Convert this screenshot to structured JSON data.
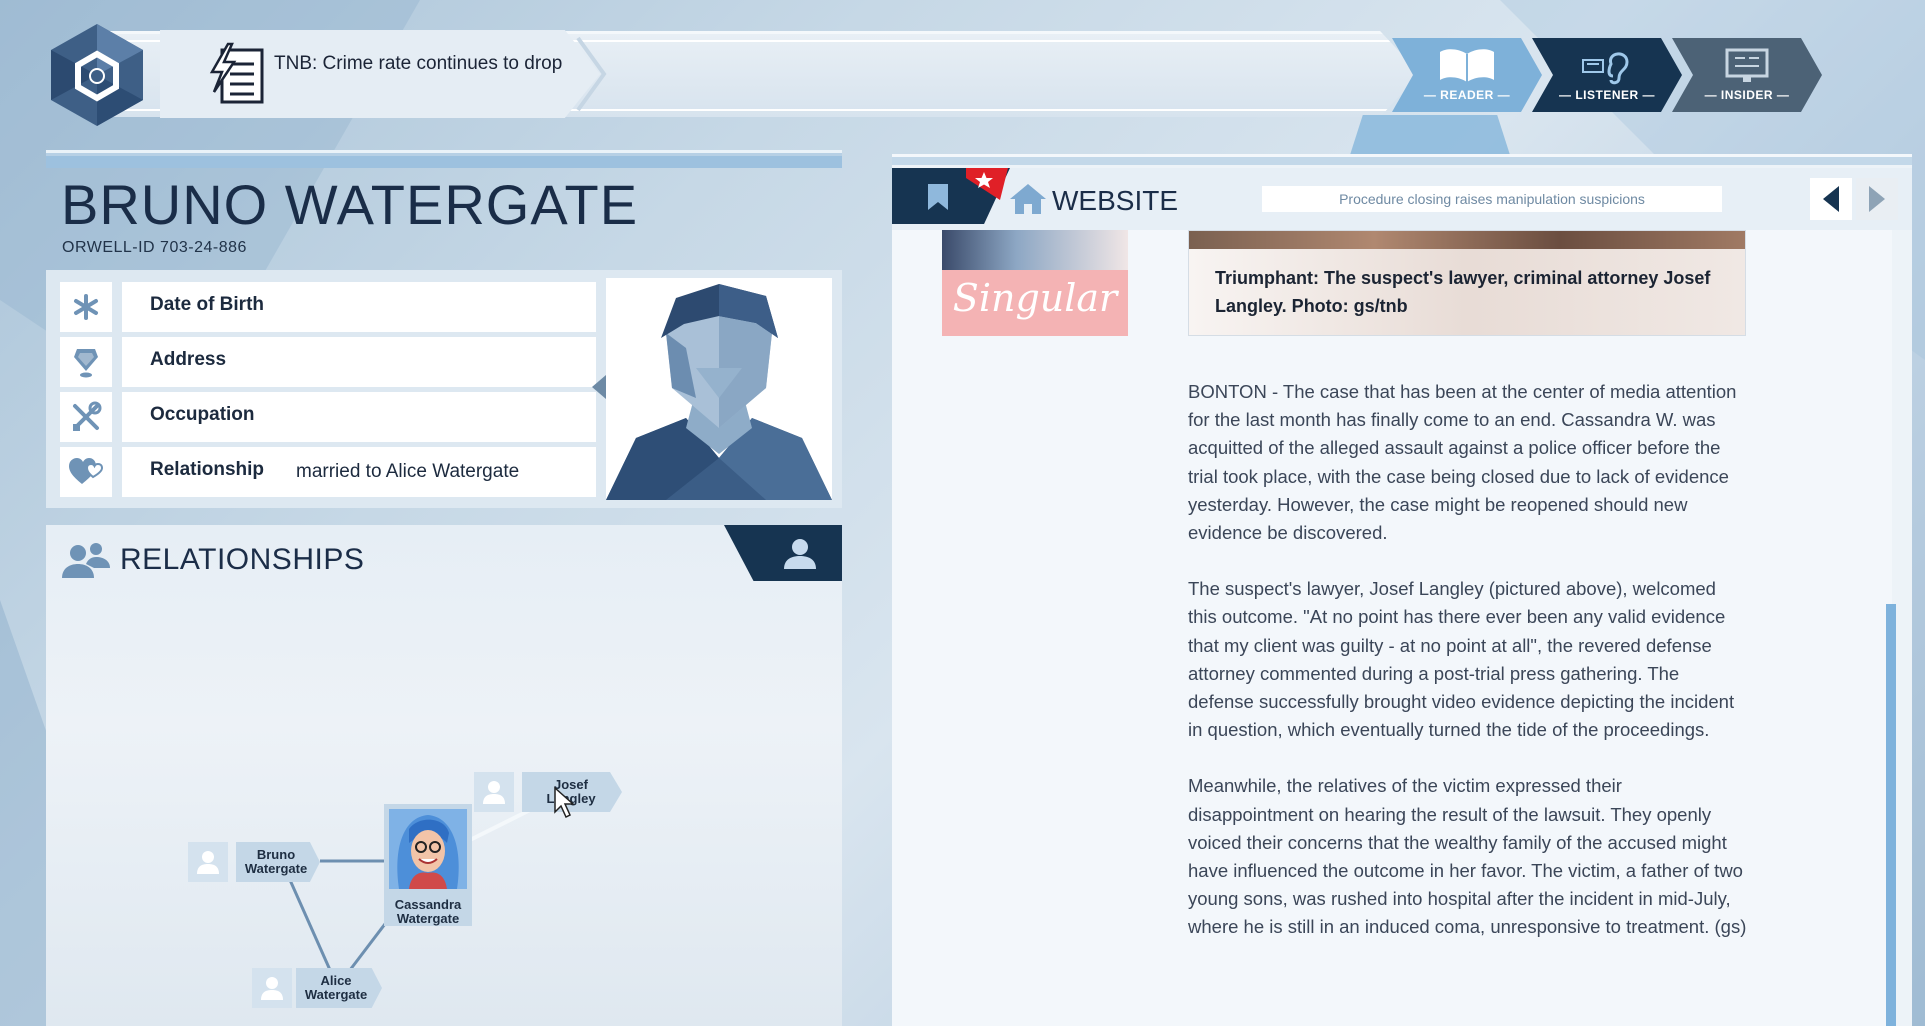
{
  "news": {
    "headline": "TNB: Crime rate continues to drop"
  },
  "modes": [
    {
      "label": "— READER —",
      "icon": "book-icon"
    },
    {
      "label": "— LISTENER —",
      "icon": "ear-icon"
    },
    {
      "label": "— INSIDER —",
      "icon": "monitor-icon"
    }
  ],
  "profile": {
    "name": "BRUNO WATERGATE",
    "orwell_id": "ORWELL-ID  703-24-886",
    "attributes": [
      {
        "label": "Date of Birth",
        "value": "",
        "icon": "asterisk-icon"
      },
      {
        "label": "Address",
        "value": "",
        "icon": "location-pin-icon"
      },
      {
        "label": "Occupation",
        "value": "",
        "icon": "tools-icon"
      },
      {
        "label": "Relationship",
        "value": "married to Alice Watergate",
        "icon": "heart-icon"
      }
    ]
  },
  "relationships": {
    "title": "RELATIONSHIPS",
    "nodes": {
      "josef": "Josef Langley",
      "bruno": "Bruno Watergate",
      "cassandra": "Cassandra Watergate",
      "alice": "Alice Watergate"
    }
  },
  "website": {
    "title": "WEBSITE",
    "headline": "Procedure closing raises manipulation suspicions",
    "ad_text": "Singular",
    "caption": "Triumphant: The suspect's lawyer, criminal attorney Josef Langley. Photo: gs/tnb",
    "paragraphs": [
      "BONTON - The case that has been at the center of media attention for the last month has finally come to an end. Cassandra W. was acquitted of the alleged assault against a police officer before the trial took place, with the case being closed due to lack of evidence yesterday. However, the case might be reopened should new evidence be discovered.",
      "The suspect's lawyer, Josef Langley (pictured above), welcomed this outcome. \"At no point has there ever been any valid evidence that my client was guilty - at no point at all\", the revered defense attorney commented during a post-trial press gathering. The defense successfully brought video evidence depicting the incident in question, which eventually turned the tide of the proceedings.",
      "Meanwhile, the relatives of the victim expressed their disappointment on hearing the result of the lawsuit. They openly voiced their concerns that the wealthy family of the accused might have influenced the outcome in her favor. The victim, a father of two young sons, was rushed into hospital after the incident in mid-July, where he is still in an induced coma, unresponsive to treatment. (gs)"
    ]
  },
  "colors": {
    "accent_dark": "#163451",
    "accent_light": "#7eb1d9",
    "ad_pink": "#f4b3b4"
  }
}
